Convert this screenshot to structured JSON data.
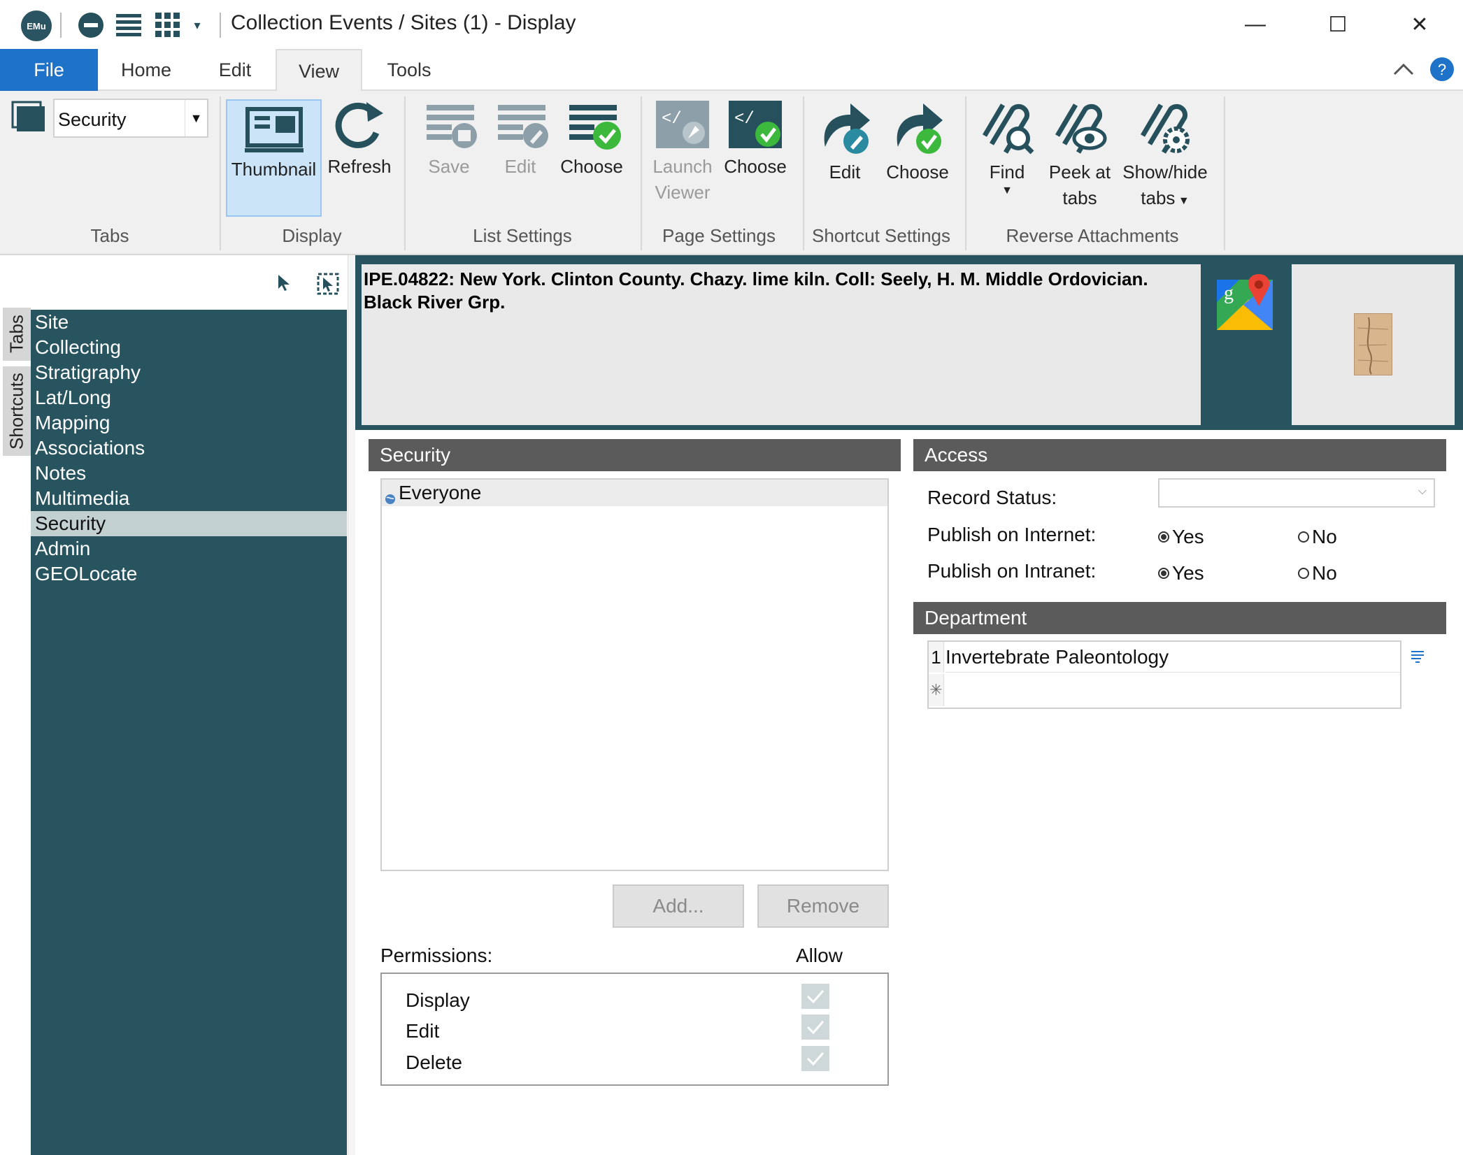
{
  "titlebar": {
    "logo": "EMu",
    "title": "Collection Events / Sites (1) - Display",
    "minimize": "—",
    "maximize": "☐",
    "close": "✕"
  },
  "ribbon_tabs": [
    "File",
    "Home",
    "Edit",
    "View",
    "Tools"
  ],
  "ribbon": {
    "tabs_combo": "Security",
    "buttons": {
      "thumbnail": "Thumbnail",
      "refresh": "Refresh",
      "list_save": "Save",
      "list_edit": "Edit",
      "list_choose": "Choose",
      "launch_viewer_1": "Launch",
      "launch_viewer_2": "Viewer",
      "page_choose": "Choose",
      "shortcut_edit": "Edit",
      "shortcut_choose": "Choose",
      "find": "Find",
      "peek_1": "Peek at",
      "peek_2": "tabs",
      "showhide_1": "Show/hide",
      "showhide_2": "tabs"
    },
    "groups": {
      "tabs": "Tabs",
      "display": "Display",
      "list_settings": "List Settings",
      "page_settings": "Page Settings",
      "shortcut_settings": "Shortcut Settings",
      "reverse_attachments": "Reverse Attachments"
    }
  },
  "side_tabs": {
    "tabs": "Tabs",
    "shortcuts": "Shortcuts"
  },
  "nav": {
    "items": [
      "Site",
      "Collecting",
      "Stratigraphy",
      "Lat/Long",
      "Mapping",
      "Associations",
      "Notes",
      "Multimedia",
      "Security",
      "Admin",
      "GEOLocate"
    ],
    "selected": "Security"
  },
  "record": {
    "description": "IPE.04822: New York. Clinton County. Chazy. lime kiln. Coll: Seely, H. M. Middle Ordovician. Black River Grp."
  },
  "security": {
    "header": "Security",
    "groups": [
      "Everyone"
    ],
    "add_button": "Add...",
    "remove_button": "Remove",
    "permissions_label": "Permissions:",
    "allow_label": "Allow",
    "permissions": [
      {
        "name": "Display",
        "allow": true
      },
      {
        "name": "Edit",
        "allow": true
      },
      {
        "name": "Delete",
        "allow": true
      }
    ]
  },
  "access": {
    "header": "Access",
    "record_status_label": "Record Status:",
    "record_status_value": "",
    "publish_internet_label": "Publish on Internet:",
    "publish_intranet_label": "Publish on Intranet:",
    "yes": "Yes",
    "no": "No",
    "publish_internet": "Yes",
    "publish_intranet": "Yes"
  },
  "department": {
    "header": "Department",
    "rows": [
      {
        "num": "1",
        "value": "Invertebrate Paleontology"
      }
    ],
    "new_row_marker": "✳"
  },
  "colors": {
    "nav_bg": "#27545f",
    "file_tab": "#1e73c9",
    "panel_header": "#5b5b5b",
    "selected_nav": "#c2d0cf"
  }
}
